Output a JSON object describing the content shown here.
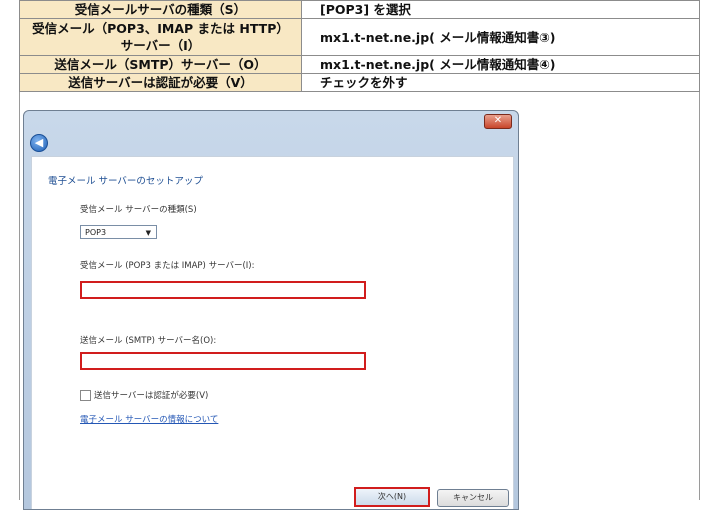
{
  "settings_table": {
    "rows": [
      {
        "label": "受信メールサーバの種類（S）",
        "value": "[POP3] を選択"
      },
      {
        "label": "受信メール（POP3、IMAP または HTTP）\nサーバー（I）",
        "value": "mx1.t-net.ne.jp( メール情報通知書③)"
      },
      {
        "label": "送信メール（SMTP）サーバー（O）",
        "value": "mx1.t-net.ne.jp( メール情報通知書④)"
      },
      {
        "label": "送信サーバーは認証が必要（V）",
        "value": "チェックを外す"
      }
    ]
  },
  "dialog": {
    "close_label": "✕",
    "back_label": "◀",
    "heading": "電子メール サーバーのセットアップ",
    "incoming_type_label": "受信メール サーバーの種類(S)",
    "incoming_type_value": "POP3",
    "incoming_server_label": "受信メール (POP3 または IMAP) サーバー(I):",
    "incoming_server_value": "",
    "outgoing_server_label": "送信メール (SMTP) サーバー名(O):",
    "outgoing_server_value": "",
    "auth_checkbox_label": "送信サーバーは認証が必要(V)",
    "auth_checked": false,
    "info_link": "電子メール サーバーの情報について",
    "next_button": "次へ(N)",
    "cancel_button": "キャンセル"
  },
  "colors": {
    "header_fill": "#f8e8c4",
    "highlight_red": "#d11d1d",
    "link_blue": "#2457b5"
  }
}
